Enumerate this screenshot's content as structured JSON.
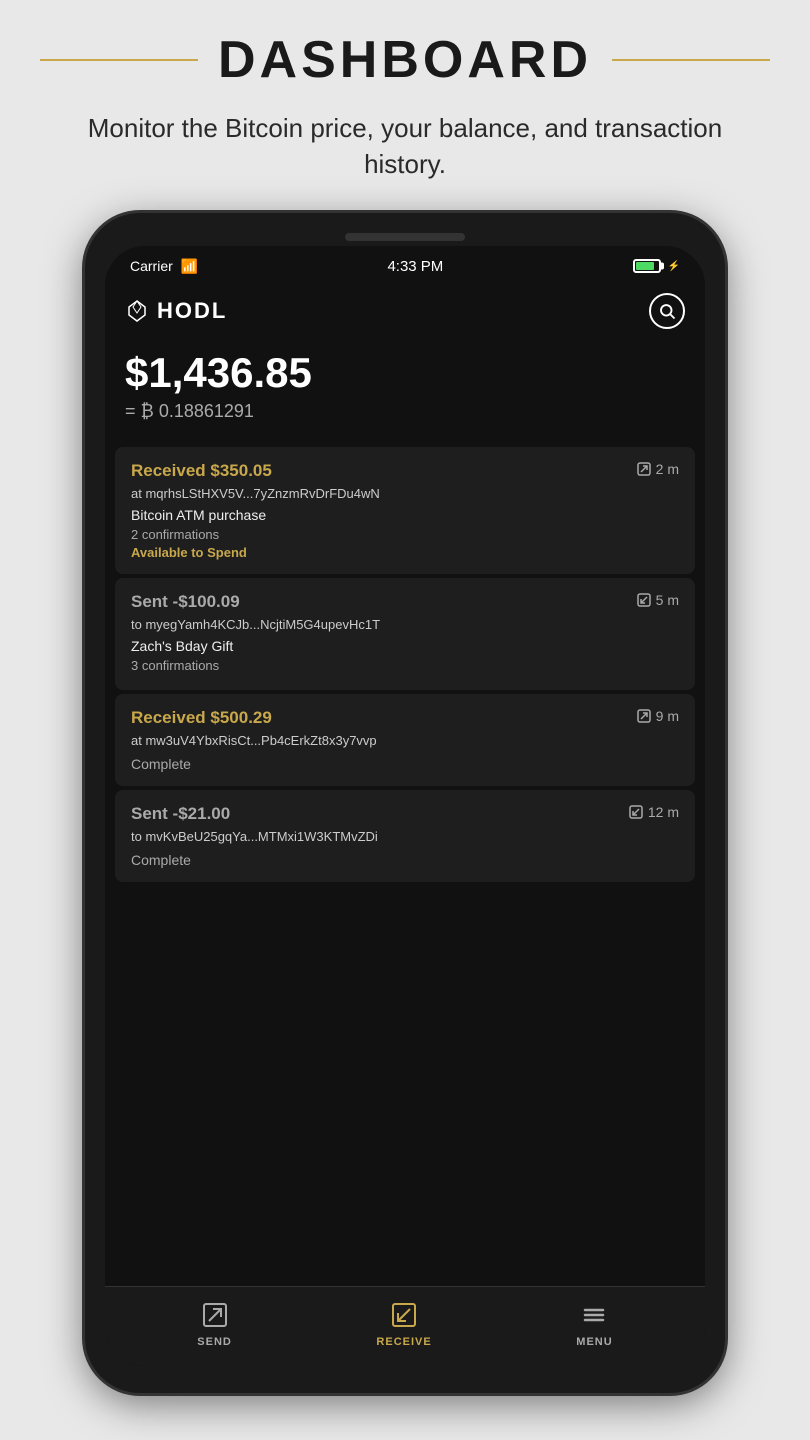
{
  "page": {
    "title": "DASHBOARD",
    "subtitle": "Monitor the Bitcoin price, your balance, and transaction history."
  },
  "status_bar": {
    "carrier": "Carrier",
    "time": "4:33 PM"
  },
  "app": {
    "name": "HODL",
    "balance_usd": "$1,436.85",
    "balance_btc": "= ₿ 0.18861291"
  },
  "transactions": [
    {
      "type": "received",
      "amount": "Received $350.05",
      "address": "at mqrhsLStHXV5V...7yZnzmRvDrFDu4wN",
      "time": "2 m",
      "label": "Bitcoin ATM purchase",
      "confirmations": "2 confirmations",
      "status": "Available to Spend",
      "status_type": "available"
    },
    {
      "type": "sent",
      "amount": "Sent -$100.09",
      "address": "to myegYamh4KCJb...NcjtiM5G4upevHc1T",
      "time": "5 m",
      "label": "Zach's Bday Gift",
      "confirmations": "3 confirmations",
      "status": "",
      "status_type": "none"
    },
    {
      "type": "received",
      "amount": "Received $500.29",
      "address": "at mw3uV4YbxRisCt...Pb4cErkZt8x3y7vvp",
      "time": "9 m",
      "label": "",
      "confirmations": "",
      "status": "Complete",
      "status_type": "complete"
    },
    {
      "type": "sent",
      "amount": "Sent -$21.00",
      "address": "to mvKvBeU25gqYa...MTMxi1W3KTMvZDi",
      "time": "12 m",
      "label": "",
      "confirmations": "",
      "status": "Complete",
      "status_type": "complete"
    }
  ],
  "nav": {
    "send_label": "SEND",
    "receive_label": "RECEIVE",
    "menu_label": "MENU"
  }
}
